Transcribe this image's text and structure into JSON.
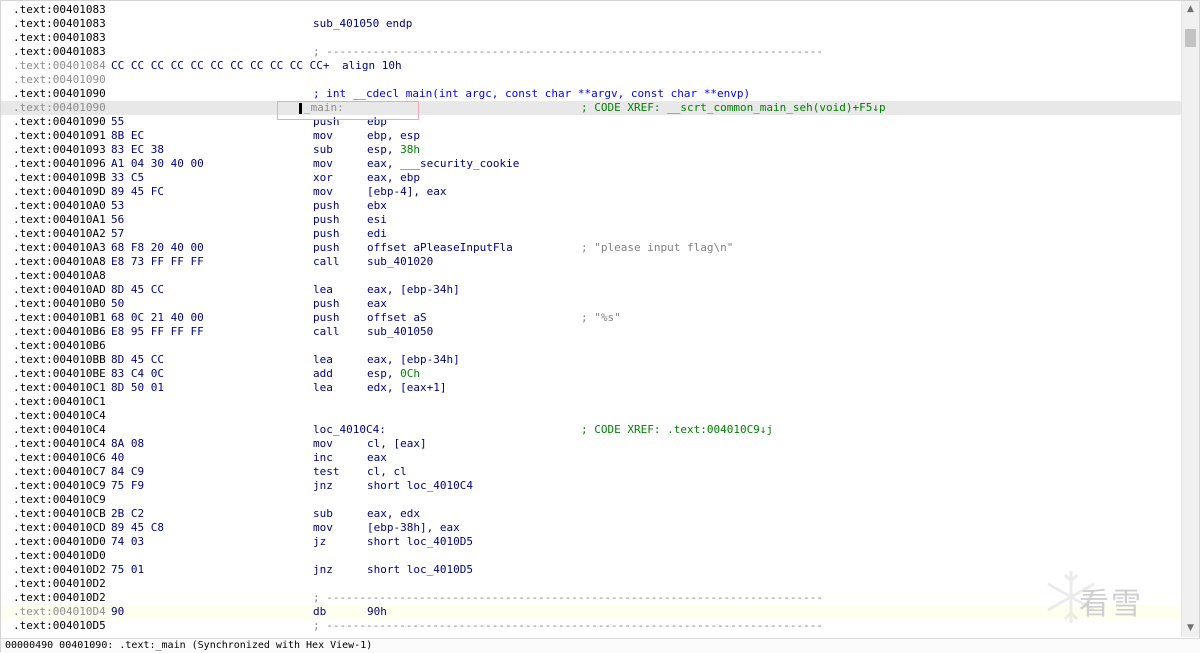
{
  "lines": [
    {
      "addr": ".text:00401083",
      "label": ""
    },
    {
      "addr": ".text:00401083",
      "label": "sub_401050 endp"
    },
    {
      "addr": ".text:00401083"
    },
    {
      "addr": ".text:00401083",
      "sep": "; ---------------------------------------------------------------------------"
    },
    {
      "addr": ".text:00401084",
      "gray": true,
      "bytes": "CC CC CC CC CC CC CC CC CC CC CC+",
      "align": "align 10h"
    },
    {
      "addr": ".text:00401090",
      "gray": true
    },
    {
      "addr": ".text:00401090",
      "proto": "; int __cdecl main(int argc, const char **argv, const char **envp)"
    },
    {
      "addr": ".text:00401090",
      "gray": true,
      "highlight": true,
      "label": "_main:",
      "xref": "; CODE XREF: __scrt_common_main_seh(void)+F5↓p"
    },
    {
      "addr": ".text:00401090",
      "bytes": "55",
      "mnem": "push",
      "ops": "ebp"
    },
    {
      "addr": ".text:00401091",
      "bytes": "8B EC",
      "mnem": "mov",
      "ops": "ebp, esp"
    },
    {
      "addr": ".text:00401093",
      "bytes": "83 EC 38",
      "mnem": "sub",
      "ops": "esp, ",
      "num": "38h"
    },
    {
      "addr": ".text:00401096",
      "bytes": "A1 04 30 40 00",
      "mnem": "mov",
      "ops": "eax, ___security_cookie"
    },
    {
      "addr": ".text:0040109B",
      "bytes": "33 C5",
      "mnem": "xor",
      "ops": "eax, ebp"
    },
    {
      "addr": ".text:0040109D",
      "bytes": "89 45 FC",
      "mnem": "mov",
      "ops": "[ebp-4], eax"
    },
    {
      "addr": ".text:004010A0",
      "bytes": "53",
      "mnem": "push",
      "ops": "ebx"
    },
    {
      "addr": ".text:004010A1",
      "bytes": "56",
      "mnem": "push",
      "ops": "esi"
    },
    {
      "addr": ".text:004010A2",
      "bytes": "57",
      "mnem": "push",
      "ops": "edi"
    },
    {
      "addr": ".text:004010A3",
      "bytes": "68 F8 20 40 00",
      "mnem": "push",
      "ops": "offset aPleaseInputFla",
      "cmt": "; \"please input flag\\n\""
    },
    {
      "addr": ".text:004010A8",
      "bytes": "E8 73 FF FF FF",
      "mnem": "call",
      "ops": "sub_401020"
    },
    {
      "addr": ".text:004010A8"
    },
    {
      "addr": ".text:004010AD",
      "bytes": "8D 45 CC",
      "mnem": "lea",
      "ops": "eax, [ebp-34h]"
    },
    {
      "addr": ".text:004010B0",
      "bytes": "50",
      "mnem": "push",
      "ops": "eax"
    },
    {
      "addr": ".text:004010B1",
      "bytes": "68 0C 21 40 00",
      "mnem": "push",
      "ops": "offset aS",
      "cmt": "; \"%s\""
    },
    {
      "addr": ".text:004010B6",
      "bytes": "E8 95 FF FF FF",
      "mnem": "call",
      "ops": "sub_401050"
    },
    {
      "addr": ".text:004010B6"
    },
    {
      "addr": ".text:004010BB",
      "bytes": "8D 45 CC",
      "mnem": "lea",
      "ops": "eax, [ebp-34h]"
    },
    {
      "addr": ".text:004010BE",
      "bytes": "83 C4 0C",
      "mnem": "add",
      "ops": "esp, ",
      "num": "0Ch"
    },
    {
      "addr": ".text:004010C1",
      "bytes": "8D 50 01",
      "mnem": "lea",
      "ops": "edx, [eax+1]"
    },
    {
      "addr": ".text:004010C1"
    },
    {
      "addr": ".text:004010C4"
    },
    {
      "addr": ".text:004010C4",
      "label": "loc_4010C4:",
      "xref": "; CODE XREF: .text:004010C9↓j"
    },
    {
      "addr": ".text:004010C4",
      "bytes": "8A 08",
      "mnem": "mov",
      "ops": "cl, [eax]"
    },
    {
      "addr": ".text:004010C6",
      "bytes": "40",
      "mnem": "inc",
      "ops": "eax"
    },
    {
      "addr": ".text:004010C7",
      "bytes": "84 C9",
      "mnem": "test",
      "ops": "cl, cl"
    },
    {
      "addr": ".text:004010C9",
      "bytes": "75 F9",
      "mnem": "jnz",
      "ops": "short loc_4010C4"
    },
    {
      "addr": ".text:004010C9"
    },
    {
      "addr": ".text:004010CB",
      "bytes": "2B C2",
      "mnem": "sub",
      "ops": "eax, edx"
    },
    {
      "addr": ".text:004010CD",
      "bytes": "89 45 C8",
      "mnem": "mov",
      "ops": "[ebp-38h], eax"
    },
    {
      "addr": ".text:004010D0",
      "bytes": "74 03",
      "mnem": "jz",
      "ops": "short loc_4010D5"
    },
    {
      "addr": ".text:004010D0"
    },
    {
      "addr": ".text:004010D2",
      "bytes": "75 01",
      "mnem": "jnz",
      "ops": "short loc_4010D5"
    },
    {
      "addr": ".text:004010D2"
    },
    {
      "addr": ".text:004010D2",
      "sep": "; ---------------------------------------------------------------------------"
    },
    {
      "addr": ".text:004010D4",
      "gray": true,
      "yellow": true,
      "bytes": "90",
      "mnem": "db",
      "ops": "90h"
    },
    {
      "addr": ".text:004010D5",
      "sep": "; ---------------------------------------------------------------------------"
    }
  ],
  "statusbar": {
    "text": "00000490 00401090: .text:_main (Synchronized with Hex View-1)"
  },
  "watermark": {
    "text": "看雪"
  }
}
